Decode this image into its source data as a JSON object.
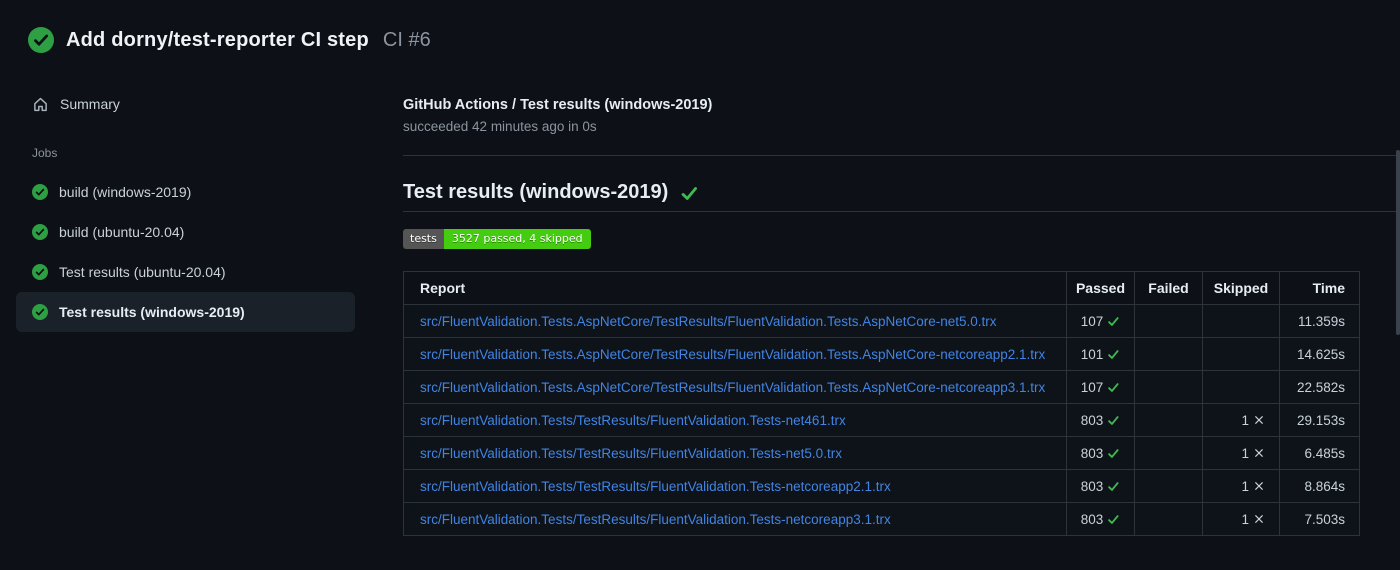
{
  "header": {
    "title": "Add dorny/test-reporter CI step",
    "run_number": "CI #6"
  },
  "sidebar": {
    "summary_label": "Summary",
    "jobs_label": "Jobs",
    "jobs": [
      {
        "label": "build (windows-2019)",
        "selected": false
      },
      {
        "label": "build (ubuntu-20.04)",
        "selected": false
      },
      {
        "label": "Test results (ubuntu-20.04)",
        "selected": false
      },
      {
        "label": "Test results (windows-2019)",
        "selected": true
      }
    ]
  },
  "main": {
    "check_title": "GitHub Actions / Test results (windows-2019)",
    "check_status": "succeeded 42 minutes ago in 0s",
    "section_heading": "Test results (windows-2019)",
    "badge": {
      "label": "tests",
      "value": "3527 passed, 4 skipped"
    },
    "table": {
      "columns": [
        "Report",
        "Passed",
        "Failed",
        "Skipped",
        "Time"
      ],
      "rows": [
        {
          "report": "src/FluentValidation.Tests.AspNetCore/TestResults/FluentValidation.Tests.AspNetCore-net5.0.trx",
          "passed": "107",
          "failed": "",
          "skipped": "",
          "time": "11.359s"
        },
        {
          "report": "src/FluentValidation.Tests.AspNetCore/TestResults/FluentValidation.Tests.AspNetCore-netcoreapp2.1.trx",
          "passed": "101",
          "failed": "",
          "skipped": "",
          "time": "14.625s"
        },
        {
          "report": "src/FluentValidation.Tests.AspNetCore/TestResults/FluentValidation.Tests.AspNetCore-netcoreapp3.1.trx",
          "passed": "107",
          "failed": "",
          "skipped": "",
          "time": "22.582s"
        },
        {
          "report": "src/FluentValidation.Tests/TestResults/FluentValidation.Tests-net461.trx",
          "passed": "803",
          "failed": "",
          "skipped": "1",
          "time": "29.153s"
        },
        {
          "report": "src/FluentValidation.Tests/TestResults/FluentValidation.Tests-net5.0.trx",
          "passed": "803",
          "failed": "",
          "skipped": "1",
          "time": "6.485s"
        },
        {
          "report": "src/FluentValidation.Tests/TestResults/FluentValidation.Tests-netcoreapp2.1.trx",
          "passed": "803",
          "failed": "",
          "skipped": "1",
          "time": "8.864s"
        },
        {
          "report": "src/FluentValidation.Tests/TestResults/FluentValidation.Tests-netcoreapp3.1.trx",
          "passed": "803",
          "failed": "",
          "skipped": "1",
          "time": "7.503s"
        }
      ]
    }
  },
  "icons": {
    "run_status": "check-circle-icon",
    "summary": "home-icon",
    "job_status": "check-circle-icon",
    "heading_status": "check-icon",
    "passed_cell": "check-icon",
    "skipped_cell": "x-icon"
  },
  "colors": {
    "status_green": "#2ea043",
    "check_green": "#3fb950",
    "link_blue": "#4184e4",
    "badge_label_bg": "#555555",
    "badge_value_bg": "#44cc11"
  }
}
